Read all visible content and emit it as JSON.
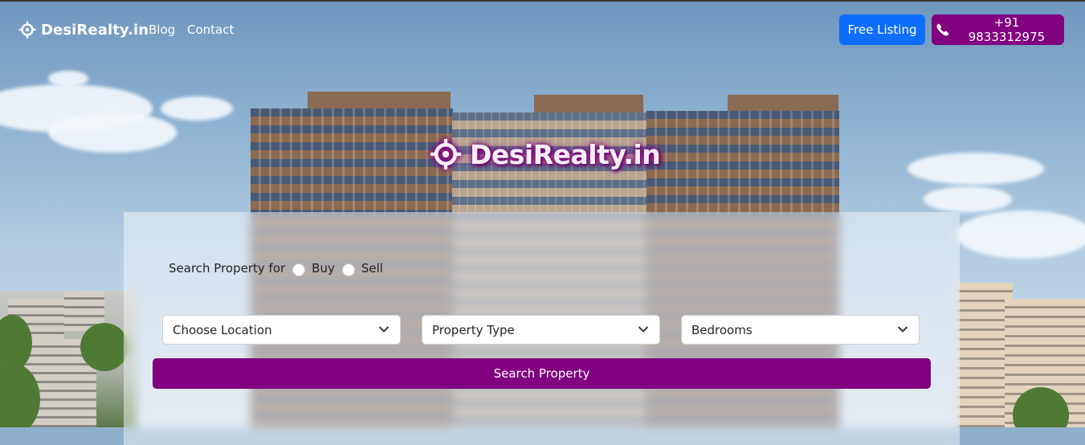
{
  "navbar": {
    "brand": "DesiRealty.in",
    "links": [
      "Blog",
      "Contact"
    ],
    "free_listing_label": "Free Listing",
    "phone_label": "+91 9833312975"
  },
  "hero": {
    "logo_text": "DesiRealty.in"
  },
  "search": {
    "prompt": "Search Property for",
    "options": [
      "Buy",
      "Sell"
    ],
    "location_placeholder": "Choose Location",
    "property_type_placeholder": "Property Type",
    "bedrooms_placeholder": "Bedrooms",
    "submit_label": "Search Property"
  },
  "colors": {
    "brand_purple": "#800080",
    "primary_blue": "#0d6efd"
  },
  "icons": {
    "brand": "location-crosshair-icon",
    "phone": "phone-icon",
    "select": "chevron-down-icon"
  }
}
